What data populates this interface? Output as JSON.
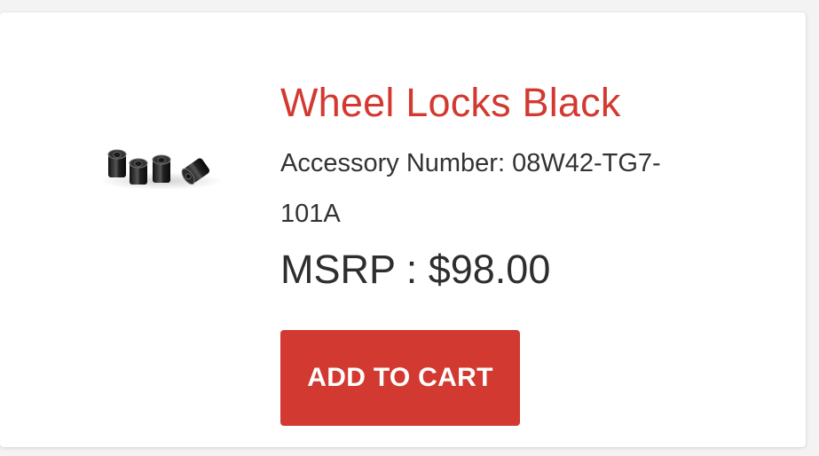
{
  "product": {
    "title": "Wheel Locks Black",
    "accessory_number_text": "Accessory Number: 08W42-TG7-101A",
    "price_text": "MSRP : $98.00",
    "add_to_cart_label": "ADD TO CART",
    "image_icon": "wheel-locks-image"
  },
  "colors": {
    "accent": "#d23a31",
    "text": "#333333",
    "card_bg": "#ffffff",
    "page_bg": "#f3f3f3"
  }
}
